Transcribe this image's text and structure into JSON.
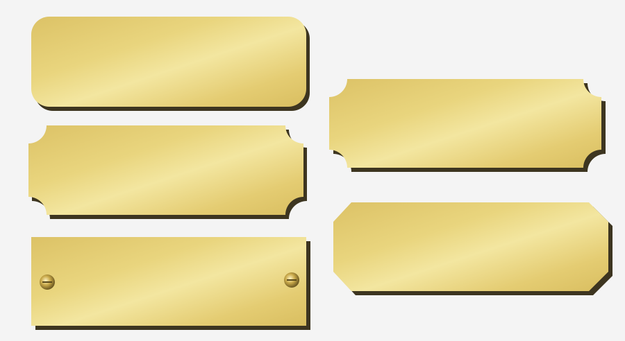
{
  "background_color": "#f4f4f4",
  "plates": [
    {
      "shape": "rounded-rectangle",
      "finish": "brushed-gold"
    },
    {
      "shape": "notched-corner-rectangle",
      "finish": "brushed-gold"
    },
    {
      "shape": "rectangle-with-screws",
      "finish": "brushed-gold",
      "screws": 2
    },
    {
      "shape": "notched-corner-rectangle",
      "finish": "brushed-gold"
    },
    {
      "shape": "clipped-corner-rectangle",
      "finish": "brushed-gold"
    }
  ],
  "colors": {
    "gold_highlight": "#f3e6a0",
    "gold_mid": "#e8d27a",
    "gold_base": "#dcc266",
    "gold_edge": "#b89a3c",
    "shadow": "#3d3520"
  }
}
